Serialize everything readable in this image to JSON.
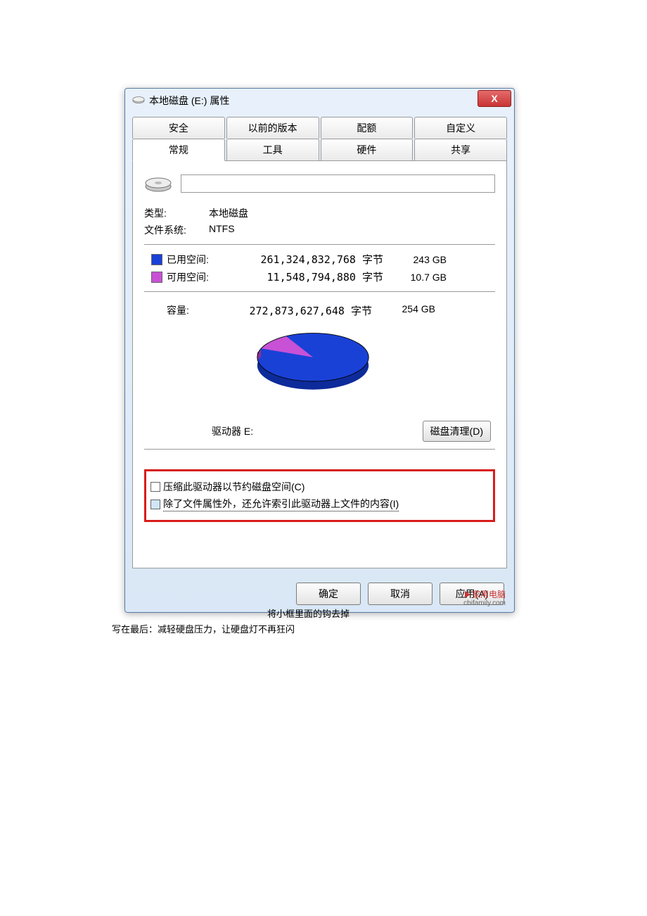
{
  "dialog": {
    "title": "本地磁盘 (E:) 属性",
    "close_icon": "X"
  },
  "tabs": {
    "row1": [
      "安全",
      "以前的版本",
      "配额",
      "自定义"
    ],
    "row2": [
      "常规",
      "工具",
      "硬件",
      "共享"
    ],
    "active": "常规"
  },
  "general": {
    "name_value": "",
    "type_label": "类型:",
    "type_value": "本地磁盘",
    "fs_label": "文件系统:",
    "fs_value": "NTFS",
    "used_label": "已用空间:",
    "used_bytes": "261,324,832,768 字节",
    "used_gb": "243 GB",
    "free_label": "可用空间:",
    "free_bytes": "11,548,794,880 字节",
    "free_gb": "10.7 GB",
    "capacity_label": "容量:",
    "capacity_bytes": "272,873,627,648 字节",
    "capacity_gb": "254 GB",
    "drive_label": "驱动器 E:",
    "cleanup_button": "磁盘清理(D)",
    "compress_label": "压缩此驱动器以节约磁盘空间(C)",
    "index_label": "除了文件属性外，还允许索引此驱动器上文件的内容(I)"
  },
  "buttons": {
    "ok": "确定",
    "cancel": "取消",
    "apply": "应用(A)"
  },
  "watermark": {
    "top": "家用电脑",
    "bottom": "cbifamily.com"
  },
  "captions": {
    "c1": "将小框里面的钩去掉",
    "c2": "写在最后：减轻硬盘压力，让硬盘灯不再狂闪"
  },
  "chart_data": {
    "type": "pie",
    "title": "驱动器 E:",
    "series": [
      {
        "name": "已用空间",
        "value": 243,
        "color": "#1a41d6"
      },
      {
        "name": "可用空间",
        "value": 10.7,
        "color": "#c851d6"
      }
    ],
    "unit": "GB",
    "total": 254
  }
}
